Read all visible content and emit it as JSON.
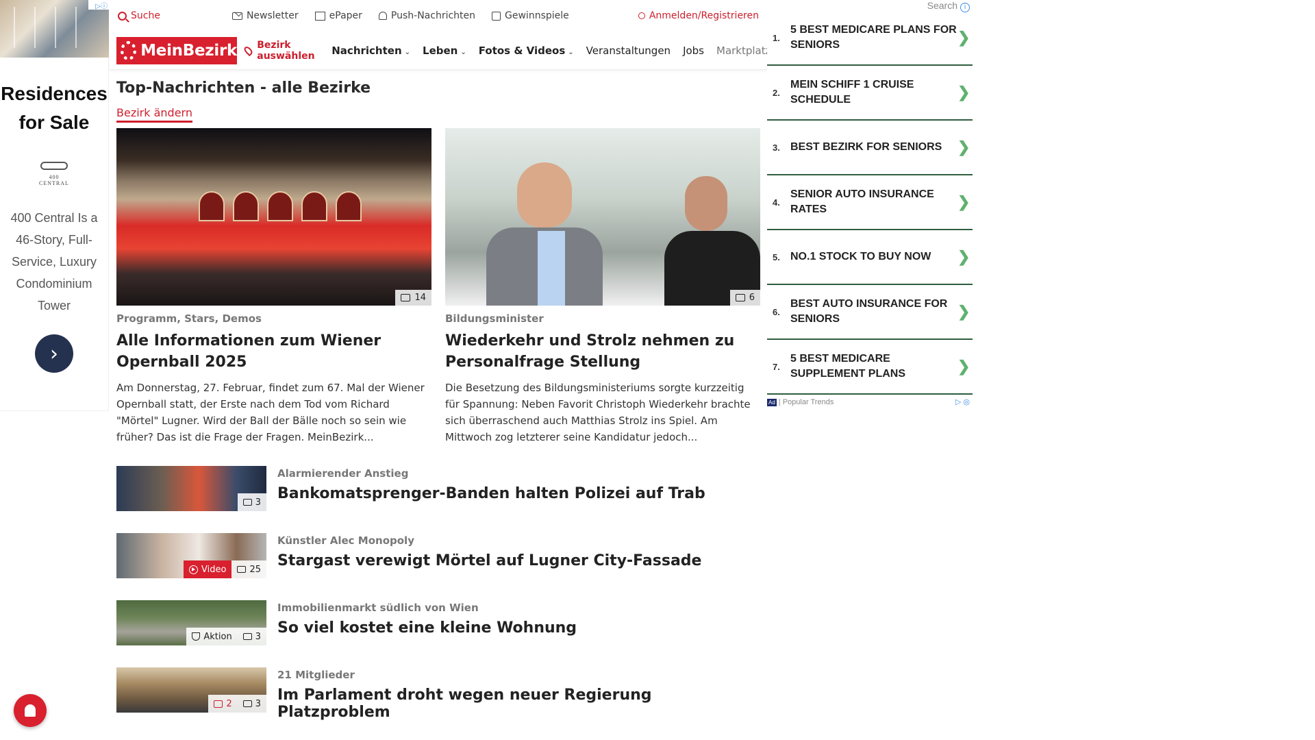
{
  "left_ad": {
    "headline": "Residences for Sale",
    "logo_text": "400 CENTRAL",
    "body": "400 Central Is a 46-Story, Full-Service, Luxury Condominium Tower",
    "cta_icon": "chevron-right-icon"
  },
  "topbar": {
    "search": "Suche",
    "newsletter": "Newsletter",
    "epaper": "ePaper",
    "push": "Push-Nachrichten",
    "games": "Gewinnspiele",
    "login": "Anmelden/Registrieren"
  },
  "nav": {
    "logo": "MeinBezirk",
    "bezirk": "Bezirk auswählen",
    "links": [
      "Nachrichten",
      "Leben",
      "Fotos & Videos",
      "Veranstaltungen",
      "Jobs",
      "Marktplatz"
    ]
  },
  "section": {
    "title": "Top-Nachrichten - alle Bezirke",
    "change": "Bezirk ändern"
  },
  "top_stories": [
    {
      "kicker": "Programm, Stars, Demos",
      "headline": "Alle Informationen zum Wiener Opernball 2025",
      "teaser": "Am Donnerstag, 27. Februar, findet zum 67. Mal der Wiener Opernball statt, der Erste nach dem Tod vom Richard \"Mörtel\" Lugner. Wird der Ball der Bälle noch so sein wie früher? Das ist die Frage der Fragen. MeinBezirk...",
      "photos": "14"
    },
    {
      "kicker": "Bildungsminister",
      "headline": "Wiederkehr und Strolz nehmen zu Personalfrage Stellung",
      "teaser": "Die Besetzung des Bildungsministeriums sorgte kurzzeitig für Spannung: Neben Favorit Christoph Wiederkehr brachte sich überraschend auch Matthias Strolz ins Spiel. Am Mittwoch zog letzterer seine Kandidatur jedoch...",
      "photos": "6"
    }
  ],
  "list": [
    {
      "kicker": "Alarmierender Anstieg",
      "title": "Bankomatsprenger-Banden halten Polizei auf Trab",
      "photos": "3"
    },
    {
      "kicker": "Künstler Alec Monopoly",
      "title": "Stargast verewigt Mörtel auf Lugner City-Fassade",
      "video": "Video",
      "photos": "25"
    },
    {
      "kicker": "Immobilienmarkt südlich von Wien",
      "title": "So viel kostet eine kleine Wohnung",
      "aktion": "Aktion",
      "photos": "3"
    },
    {
      "kicker": "21 Mitglieder",
      "title": "Im Parlament droht wegen neuer Regierung Platzproblem",
      "comments": "2",
      "photos": "3"
    }
  ],
  "right_ad": {
    "search_label": "Search",
    "items": [
      {
        "num": "1.",
        "text": "5 Best Medicare Plans for Seniors"
      },
      {
        "num": "2.",
        "text": "Mein Schiff 1 Cruise Schedule"
      },
      {
        "num": "3.",
        "text": "Best Bezirk for Seniors"
      },
      {
        "num": "4.",
        "text": "Senior Auto Insurance Rates"
      },
      {
        "num": "5.",
        "text": "No.1 Stock to Buy Now"
      },
      {
        "num": "6.",
        "text": "Best Auto Insurance for Seniors"
      },
      {
        "num": "7.",
        "text": "5 Best Medicare Supplement Plans"
      }
    ],
    "footer": "Popular Trends",
    "ad_tag": "Ad"
  },
  "colors": {
    "brand": "#d8202e",
    "ad_border": "#2f5e3f",
    "ad_arrow": "#5fb16f"
  }
}
